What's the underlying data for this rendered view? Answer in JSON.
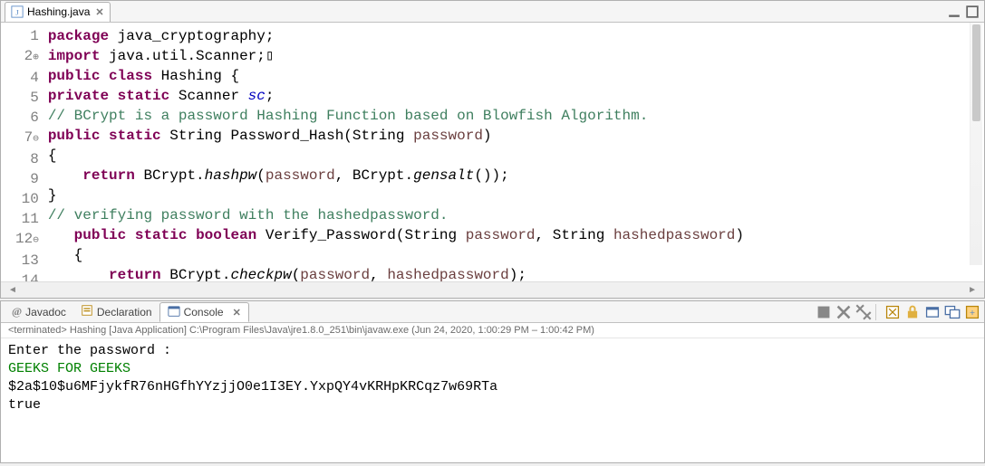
{
  "editor": {
    "tab": {
      "filename": "Hashing.java"
    },
    "lines": [
      {
        "n": "1",
        "fold": "",
        "html": "<span class='kw'>package</span> java_cryptography;"
      },
      {
        "n": "2",
        "fold": "⊕",
        "html": "<span class='kw'>import</span> java.util.Scanner;▯"
      },
      {
        "n": "4",
        "fold": "",
        "html": "<span class='kw'>public class</span> Hashing {"
      },
      {
        "n": "5",
        "fold": "",
        "html": "<span class='kw'>private static</span> Scanner <span class='fld'>sc</span>;"
      },
      {
        "n": "6",
        "fold": "",
        "html": "<span class='cm'>// BCrypt is a password Hashing Function based on Blowfish Algorithm.</span>"
      },
      {
        "n": "7",
        "fold": "⊖",
        "html": "<span class='kw'>public static</span> String Password_Hash(String <span class='pm'>password</span>)"
      },
      {
        "n": "8",
        "fold": "",
        "html": "{"
      },
      {
        "n": "9",
        "fold": "",
        "html": "    <span class='kw'>return</span> BCrypt.<span class='it'>hashpw</span>(<span class='pm'>password</span>, BCrypt.<span class='it'>gensalt</span>());"
      },
      {
        "n": "10",
        "fold": "",
        "html": "}"
      },
      {
        "n": "11",
        "fold": "",
        "html": "<span class='cm'>// verifying password with the hashedpassword.</span>"
      },
      {
        "n": "12",
        "fold": "⊖",
        "html": "   <span class='kw'>public static boolean</span> Verify_Password(String <span class='pm'>password</span>, String <span class='pm'>hashedpassword</span>)"
      },
      {
        "n": "13",
        "fold": "",
        "html": "   {"
      },
      {
        "n": "14",
        "fold": "",
        "html": "       <span class='kw'>return</span> BCrypt.<span class='it'>checkpw</span>(<span class='pm'>password</span>, <span class='pm'>hashedpassword</span>);"
      }
    ]
  },
  "views": {
    "javadoc": "Javadoc",
    "declaration": "Declaration",
    "console": "Console"
  },
  "status": "<terminated> Hashing [Java Application] C:\\Program Files\\Java\\jre1.8.0_251\\bin\\javaw.exe  (Jun 24, 2020, 1:00:29 PM – 1:00:42 PM)",
  "console": {
    "prompt": "Enter the password : ",
    "input": "GEEKS FOR GEEKS",
    "hash": "$2a$10$u6MFjykfR76nHGfhYYzjjO0e1I3EY.YxpQY4vKRHpKRCqz7w69RTa",
    "result": "true"
  }
}
